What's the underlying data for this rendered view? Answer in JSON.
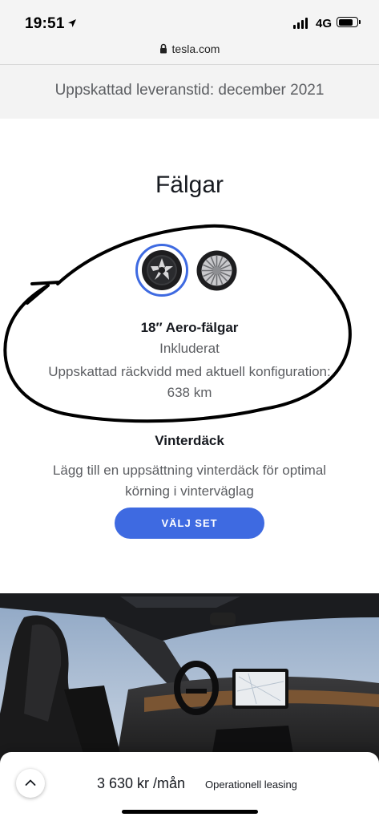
{
  "status_bar": {
    "time": "19:51",
    "network": "4G",
    "battery_level": 0.85
  },
  "browser": {
    "url": "tesla.com"
  },
  "delivery": {
    "text": "Uppskattad leveranstid: december 2021"
  },
  "wheels": {
    "title": "Fälgar",
    "options": [
      {
        "icon": "aero-wheel-icon",
        "selected": true
      },
      {
        "icon": "sport-wheel-icon",
        "selected": false
      }
    ],
    "selected_name": "18″ Aero-fälgar",
    "selected_price": "Inkluderat",
    "range_text": "Uppskattad räckvidd med aktuell konfiguration: 638 km"
  },
  "winter_tires": {
    "title": "Vinterdäck",
    "description": "Lägg till en uppsättning vinterdäck för optimal körning i vinterväglag",
    "button_label": "VÄLJ SET"
  },
  "footer": {
    "price": "3 630 kr /mån",
    "price_label": "Operationell leasing"
  },
  "colors": {
    "accent": "#3e6ae1",
    "text_primary": "#171a20",
    "text_secondary": "#5c5e62"
  }
}
